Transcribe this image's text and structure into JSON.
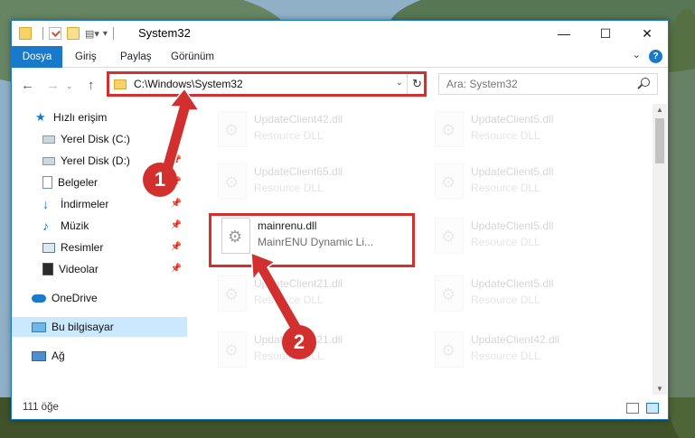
{
  "window": {
    "title": "System32"
  },
  "ribbon": {
    "tabs": [
      "Dosya",
      "Giriş",
      "Paylaş",
      "Görünüm"
    ],
    "help": "?"
  },
  "address": {
    "path": "C:\\Windows\\System32",
    "search_placeholder": "Ara: System32"
  },
  "sidebar": {
    "items": [
      {
        "label": "Hızlı erişim",
        "icon": "star-icon",
        "pinned": false
      },
      {
        "label": "Yerel Disk (C:)",
        "icon": "drive-icon",
        "pinned": true
      },
      {
        "label": "Yerel Disk (D:)",
        "icon": "drive-icon",
        "pinned": true
      },
      {
        "label": "Belgeler",
        "icon": "document-icon",
        "pinned": true
      },
      {
        "label": "İndirmeler",
        "icon": "download-arrow-icon",
        "pinned": true
      },
      {
        "label": "Müzik",
        "icon": "music-note-icon",
        "pinned": true
      },
      {
        "label": "Resimler",
        "icon": "pictures-icon",
        "pinned": true
      },
      {
        "label": "Videolar",
        "icon": "film-icon",
        "pinned": true
      },
      {
        "label": "OneDrive",
        "icon": "cloud-icon",
        "pinned": false
      },
      {
        "label": "Bu bilgisayar",
        "icon": "computer-icon",
        "pinned": false
      },
      {
        "label": "Ağ",
        "icon": "network-icon",
        "pinned": false
      }
    ]
  },
  "files": [
    {
      "name": "UpdateClient42.dll",
      "desc": "Resource DLL",
      "faded": true
    },
    {
      "name": "UpdateClient5.dll",
      "desc": "Resource DLL",
      "faded": true
    },
    {
      "name": "UpdateClient65.dll",
      "desc": "Resource DLL",
      "faded": true
    },
    {
      "name": "UpdateClient5.dll",
      "desc": "Resource DLL",
      "faded": true
    },
    {
      "name": "mainrenu.dll",
      "desc": "MainrENU Dynamic Li...",
      "faded": false
    },
    {
      "name": "UpdateClient5.dll",
      "desc": "Resource DLL",
      "faded": true
    },
    {
      "name": "UpdateClient21.dll",
      "desc": "Resource DLL",
      "faded": true
    },
    {
      "name": "UpdateClient5.dll",
      "desc": "Resource DLL",
      "faded": true
    },
    {
      "name": "UpdateClient21.dll",
      "desc": "Resource DLL",
      "faded": true
    },
    {
      "name": "UpdateClient42.dll",
      "desc": "Resource DLL",
      "faded": true
    }
  ],
  "status": {
    "count": "111 öğe"
  },
  "callouts": [
    "1",
    "2"
  ],
  "colors": {
    "accent": "#1979ca",
    "highlight": "#d22f2f",
    "selected": "#cce8ff"
  }
}
